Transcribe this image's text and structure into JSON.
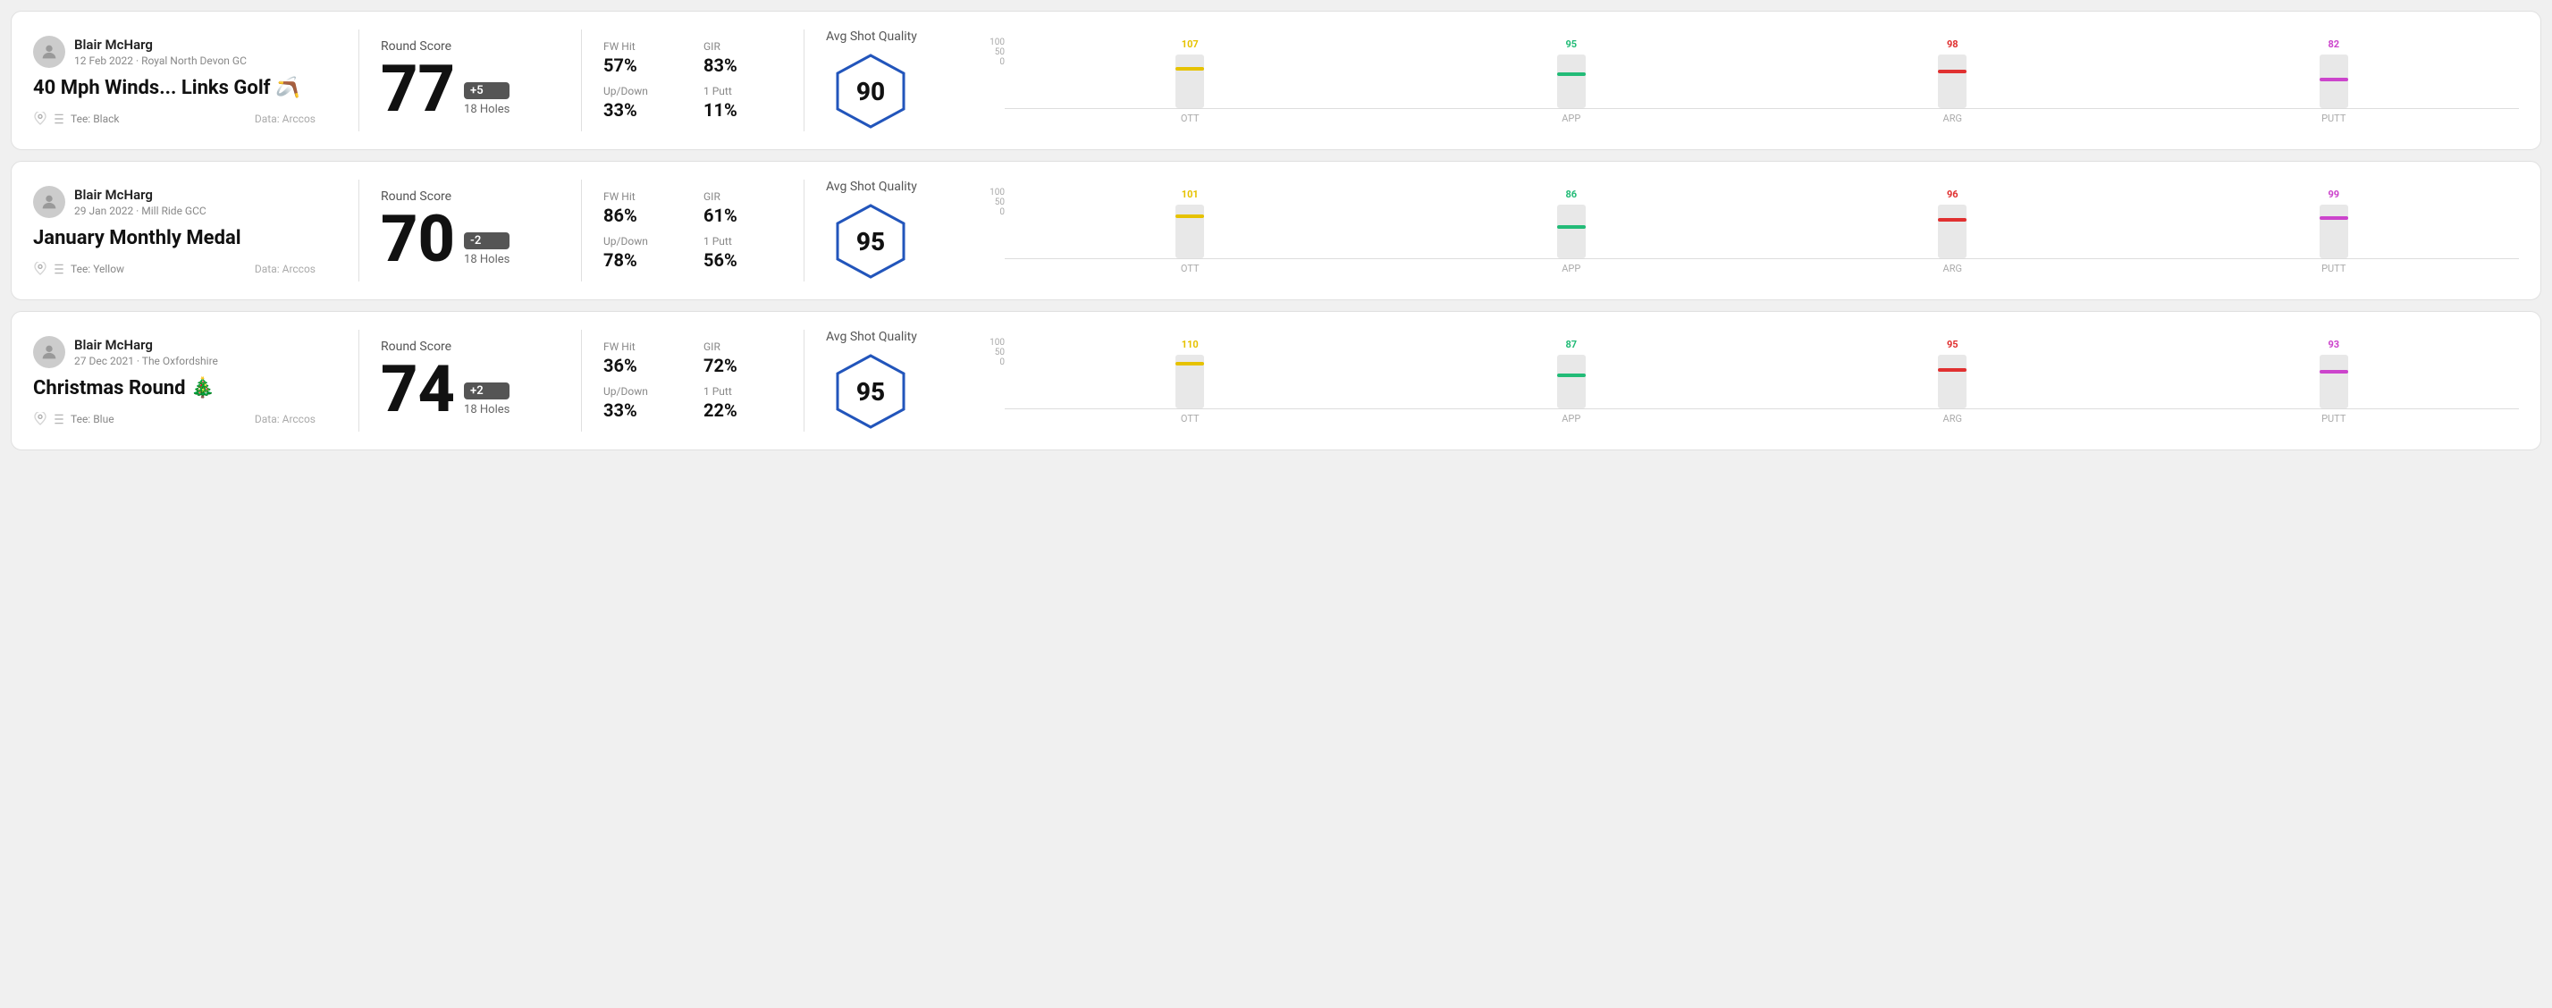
{
  "rounds": [
    {
      "id": "round1",
      "player": {
        "name": "Blair McHarg",
        "date": "12 Feb 2022",
        "course": "Royal North Devon GC"
      },
      "title": "40 Mph Winds... Links Golf",
      "title_emoji": "🪃",
      "tee": "Black",
      "data_source": "Data: Arccos",
      "score": {
        "label": "Round Score",
        "value": "77",
        "badge": "+5",
        "holes": "18 Holes"
      },
      "stats": {
        "fw_hit_label": "FW Hit",
        "fw_hit_value": "57%",
        "gir_label": "GIR",
        "gir_value": "83%",
        "updown_label": "Up/Down",
        "updown_value": "33%",
        "oneputt_label": "1 Putt",
        "oneputt_value": "11%"
      },
      "quality": {
        "label": "Avg Shot Quality",
        "value": "90"
      },
      "chart": {
        "max": 100,
        "columns": [
          {
            "label": "OTT",
            "value": 107,
            "color": "#e6c200",
            "bar_pct": 75
          },
          {
            "label": "APP",
            "value": 95,
            "color": "#22bb77",
            "bar_pct": 65
          },
          {
            "label": "ARG",
            "value": 98,
            "color": "#e03030",
            "bar_pct": 70
          },
          {
            "label": "PUTT",
            "value": 82,
            "color": "#cc44cc",
            "bar_pct": 55
          }
        ]
      }
    },
    {
      "id": "round2",
      "player": {
        "name": "Blair McHarg",
        "date": "29 Jan 2022",
        "course": "Mill Ride GCC"
      },
      "title": "January Monthly Medal",
      "title_emoji": "",
      "tee": "Yellow",
      "data_source": "Data: Arccos",
      "score": {
        "label": "Round Score",
        "value": "70",
        "badge": "-2",
        "holes": "18 Holes"
      },
      "stats": {
        "fw_hit_label": "FW Hit",
        "fw_hit_value": "86%",
        "gir_label": "GIR",
        "gir_value": "61%",
        "updown_label": "Up/Down",
        "updown_value": "78%",
        "oneputt_label": "1 Putt",
        "oneputt_value": "56%"
      },
      "quality": {
        "label": "Avg Shot Quality",
        "value": "95"
      },
      "chart": {
        "max": 100,
        "columns": [
          {
            "label": "OTT",
            "value": 101,
            "color": "#e6c200",
            "bar_pct": 80
          },
          {
            "label": "APP",
            "value": 86,
            "color": "#22bb77",
            "bar_pct": 60
          },
          {
            "label": "ARG",
            "value": 96,
            "color": "#e03030",
            "bar_pct": 72
          },
          {
            "label": "PUTT",
            "value": 99,
            "color": "#cc44cc",
            "bar_pct": 76
          }
        ]
      }
    },
    {
      "id": "round3",
      "player": {
        "name": "Blair McHarg",
        "date": "27 Dec 2021",
        "course": "The Oxfordshire"
      },
      "title": "Christmas Round",
      "title_emoji": "🎄",
      "tee": "Blue",
      "data_source": "Data: Arccos",
      "score": {
        "label": "Round Score",
        "value": "74",
        "badge": "+2",
        "holes": "18 Holes"
      },
      "stats": {
        "fw_hit_label": "FW Hit",
        "fw_hit_value": "36%",
        "gir_label": "GIR",
        "gir_value": "72%",
        "updown_label": "Up/Down",
        "updown_value": "33%",
        "oneputt_label": "1 Putt",
        "oneputt_value": "22%"
      },
      "quality": {
        "label": "Avg Shot Quality",
        "value": "95"
      },
      "chart": {
        "max": 100,
        "columns": [
          {
            "label": "OTT",
            "value": 110,
            "color": "#e6c200",
            "bar_pct": 85
          },
          {
            "label": "APP",
            "value": 87,
            "color": "#22bb77",
            "bar_pct": 62
          },
          {
            "label": "ARG",
            "value": 95,
            "color": "#e03030",
            "bar_pct": 72
          },
          {
            "label": "PUTT",
            "value": 93,
            "color": "#cc44cc",
            "bar_pct": 70
          }
        ]
      }
    }
  ]
}
